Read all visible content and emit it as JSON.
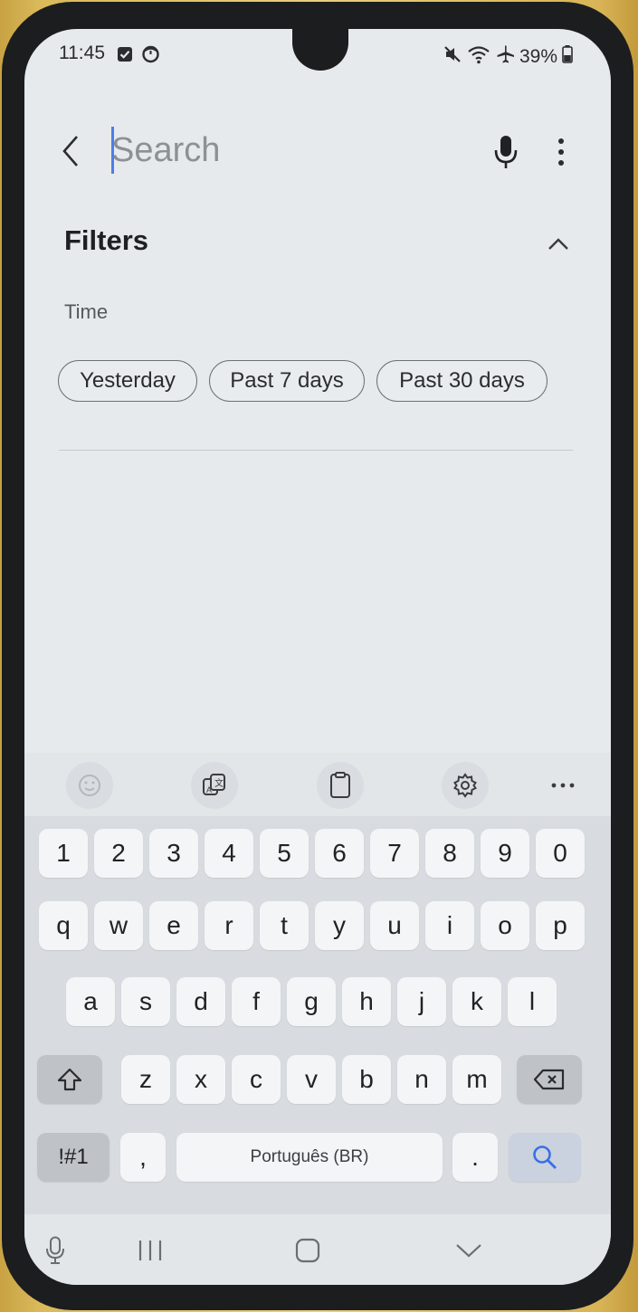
{
  "status_bar": {
    "time": "11:45",
    "battery": "39%",
    "notification_icons": [
      "checkbox-icon",
      "timer-icon"
    ],
    "system_icons": [
      "mute-icon",
      "wifi-icon",
      "airplane-icon",
      "battery-icon"
    ]
  },
  "search": {
    "placeholder": "Search",
    "value": ""
  },
  "filters": {
    "title": "Filters",
    "time_label": "Time",
    "chips": [
      "Yesterday",
      "Past 7 days",
      "Past 30 days"
    ]
  },
  "keyboard": {
    "toolbar_icons": [
      "emoji-icon",
      "translate-icon",
      "clipboard-icon",
      "settings-icon",
      "more-icon"
    ],
    "number_row": [
      "1",
      "2",
      "3",
      "4",
      "5",
      "6",
      "7",
      "8",
      "9",
      "0"
    ],
    "row1": [
      "q",
      "w",
      "e",
      "r",
      "t",
      "y",
      "u",
      "i",
      "o",
      "p"
    ],
    "row2": [
      "a",
      "s",
      "d",
      "f",
      "g",
      "h",
      "j",
      "k",
      "l"
    ],
    "row3": [
      "z",
      "x",
      "c",
      "v",
      "b",
      "n",
      "m"
    ],
    "symbols_key": "!#1",
    "comma_key": ",",
    "space_label": "Português (BR)",
    "period_key": "."
  },
  "colors": {
    "screen_bg": "#e7eaed",
    "keyboard_bg": "#d8dbdf",
    "accent": "#3a6fe8"
  }
}
